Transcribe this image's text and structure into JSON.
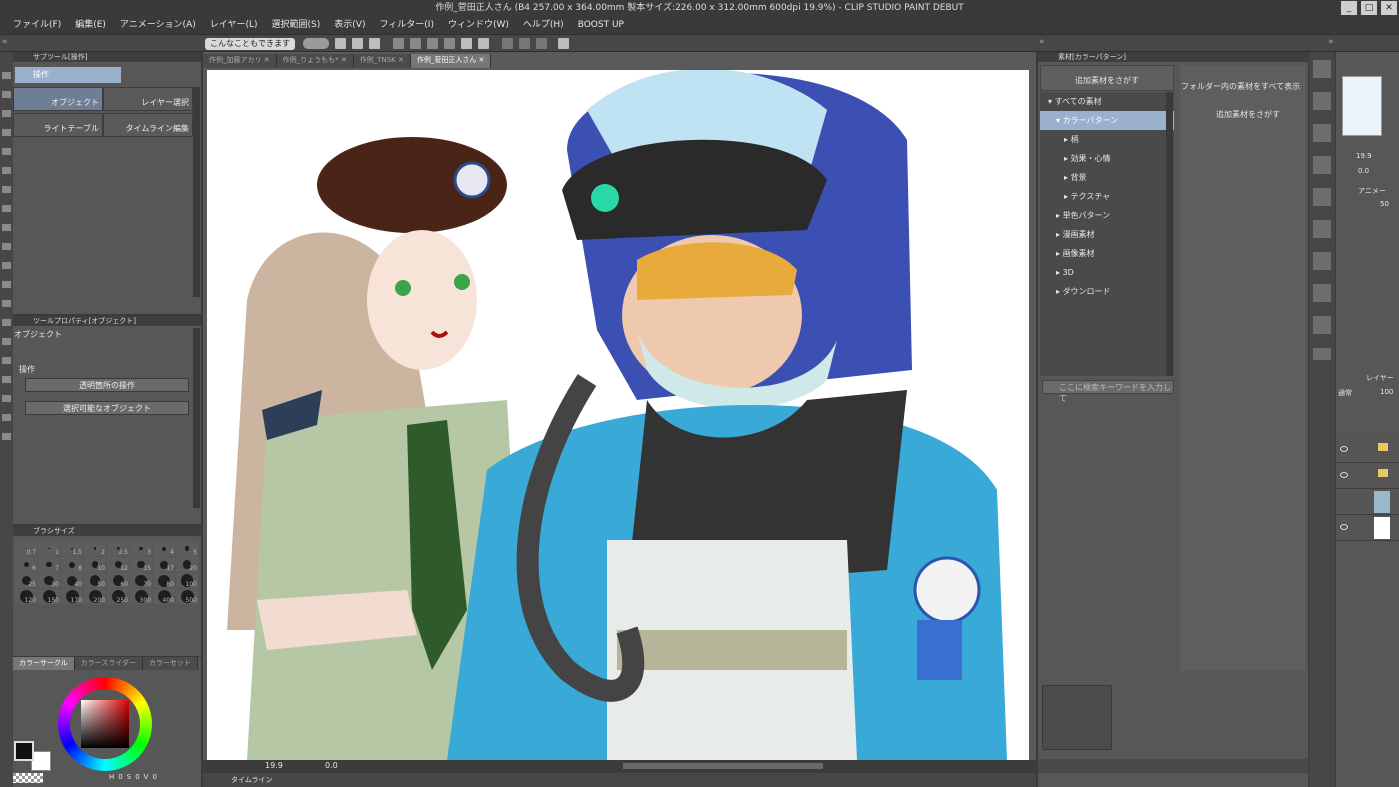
{
  "window": {
    "title": "作例_菅田正人さん (B4 257.00 x 364.00mm 製本サイズ:226.00 x 312.00mm 600dpi 19.9%) - CLIP STUDIO PAINT DEBUT"
  },
  "menu": [
    "ファイル(F)",
    "編集(E)",
    "アニメーション(A)",
    "レイヤー(L)",
    "選択範囲(S)",
    "表示(V)",
    "フィルター(I)",
    "ウィンドウ(W)",
    "ヘルプ(H)",
    "BOOST UP"
  ],
  "command_bar": {
    "help_button": "こんなこともできます"
  },
  "sub_tool": {
    "panel_title": "サブツール[操作]",
    "group": "操作",
    "items": [
      "オブジェクト",
      "レイヤー選択",
      "ライトテーブル",
      "タイムライン編集"
    ]
  },
  "tool_property": {
    "panel_title": "ツールプロパティ[オブジェクト]",
    "heading": "オブジェクト",
    "section": "操作",
    "drop1": "透明箇所の操作",
    "drop2": "選択可能なオブジェクト"
  },
  "brush_size": {
    "panel_title": "ブラシサイズ",
    "sizes": [
      "0.7",
      "1",
      "1.5",
      "2",
      "2.5",
      "3",
      "4",
      "5",
      "6",
      "7",
      "8",
      "10",
      "12",
      "15",
      "17",
      "20",
      "25",
      "30",
      "40",
      "50",
      "60",
      "70",
      "80",
      "100",
      "120",
      "150",
      "170",
      "200",
      "250",
      "300",
      "400",
      "500"
    ]
  },
  "color_tabs": [
    "カラーサークル",
    "カラースライダー",
    "カラーセット"
  ],
  "color": {
    "main": "#111111",
    "sub": "#ffffff",
    "picked": "#b01010"
  },
  "color_values": {
    "h": "0",
    "s": "0",
    "v": "0"
  },
  "canvas_tabs": [
    "作例_加藤アカリ",
    "作例_りょうもも*",
    "作例_TNSK",
    "作例_菅田正人さん"
  ],
  "status": {
    "zoom": "19.9",
    "angle": "0.0"
  },
  "timeline": {
    "label": "タイムライン"
  },
  "material": {
    "panel_title": "素材[カラーパターン]",
    "find_button": "追加素材をさがす",
    "show_all": "フォルダー内の素材をすべて表示",
    "find_button2": "追加素材をさがす",
    "search_placeholder": "ここに検索キーワードを入力して",
    "tree": [
      {
        "label": "すべての素材",
        "level": 0,
        "open": true
      },
      {
        "label": "カラーパターン",
        "level": 1,
        "open": true,
        "selected": true
      },
      {
        "label": "柄",
        "level": 2
      },
      {
        "label": "効果・心情",
        "level": 2
      },
      {
        "label": "背景",
        "level": 2
      },
      {
        "label": "テクスチャ",
        "level": 2
      },
      {
        "label": "単色パターン",
        "level": 1
      },
      {
        "label": "漫画素材",
        "level": 1
      },
      {
        "label": "画像素材",
        "level": 1
      },
      {
        "label": "3D",
        "level": 1
      },
      {
        "label": "ダウンロード",
        "level": 1
      }
    ]
  },
  "navigator": {
    "zoom": "19.9",
    "angle": "0.0"
  },
  "animation_panel": {
    "label": "アニメー",
    "opacity": "50"
  },
  "layer_panel": {
    "label": "レイヤー",
    "blend": "通常",
    "opacity": "100"
  }
}
